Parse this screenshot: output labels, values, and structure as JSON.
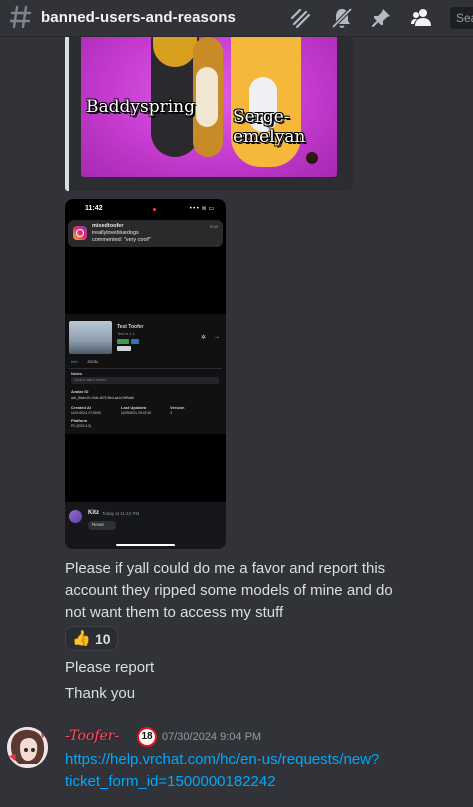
{
  "header": {
    "channel": "banned-users-and-reasons",
    "search_label": "Sea"
  },
  "embed_image": {
    "caption_left": "Baddyspring",
    "caption_right": "Serge-emelyan"
  },
  "phone": {
    "time": "11:42",
    "status": "••• ≋ ▭",
    "notification": {
      "title": "mixedtoofer",
      "line2": "ireallylovebluedogs",
      "line3": "commented: \"very cool!\"",
      "time": "now"
    },
    "vrc": {
      "name": "Test Toofer",
      "subtitle": "Test is 1.1",
      "tab1": "Info",
      "tab2": "JSON",
      "notes_label": "Notes",
      "notes_placeholder": "Click to add a memo",
      "avatar_id_label": "Avatar ID",
      "avatar_id": "avtr_f8a4c47c-f0d4-4675-9fe4-aa1c7dff9a4b",
      "created_label": "Created At",
      "created": "11/01/2024, 07:09:00",
      "updated_label": "Last Updated",
      "updated": "11/09/2024, 09:02:16",
      "version_label": "Version",
      "version": "3",
      "platform_label": "Platform",
      "platform": "PC (2022.4.3)"
    },
    "reply": {
      "name": "Kitz",
      "time": "Today at 11:42 PM",
      "react": "Reset"
    }
  },
  "messages": {
    "line1": "Please if yall could do me a favor and report this",
    "line2": "account they ripped some models of mine and do",
    "line3": "not want them to access my stuff",
    "reaction_emoji": "👍",
    "reaction_count": "10",
    "please_report": "Please report",
    "thank_you": "Thank you"
  },
  "next_message": {
    "author": "-Toofer-",
    "badge": "18",
    "timestamp": "07/30/2024 9:04 PM",
    "link_line1": "https://help.vrchat.com/hc/en-us/requests/new?",
    "link_line2": "ticket_form_id=1500000182242"
  },
  "colors": {
    "background": "#313338",
    "link": "#00a8fc",
    "author": "#ff4d63",
    "muted": "#949ba4"
  }
}
